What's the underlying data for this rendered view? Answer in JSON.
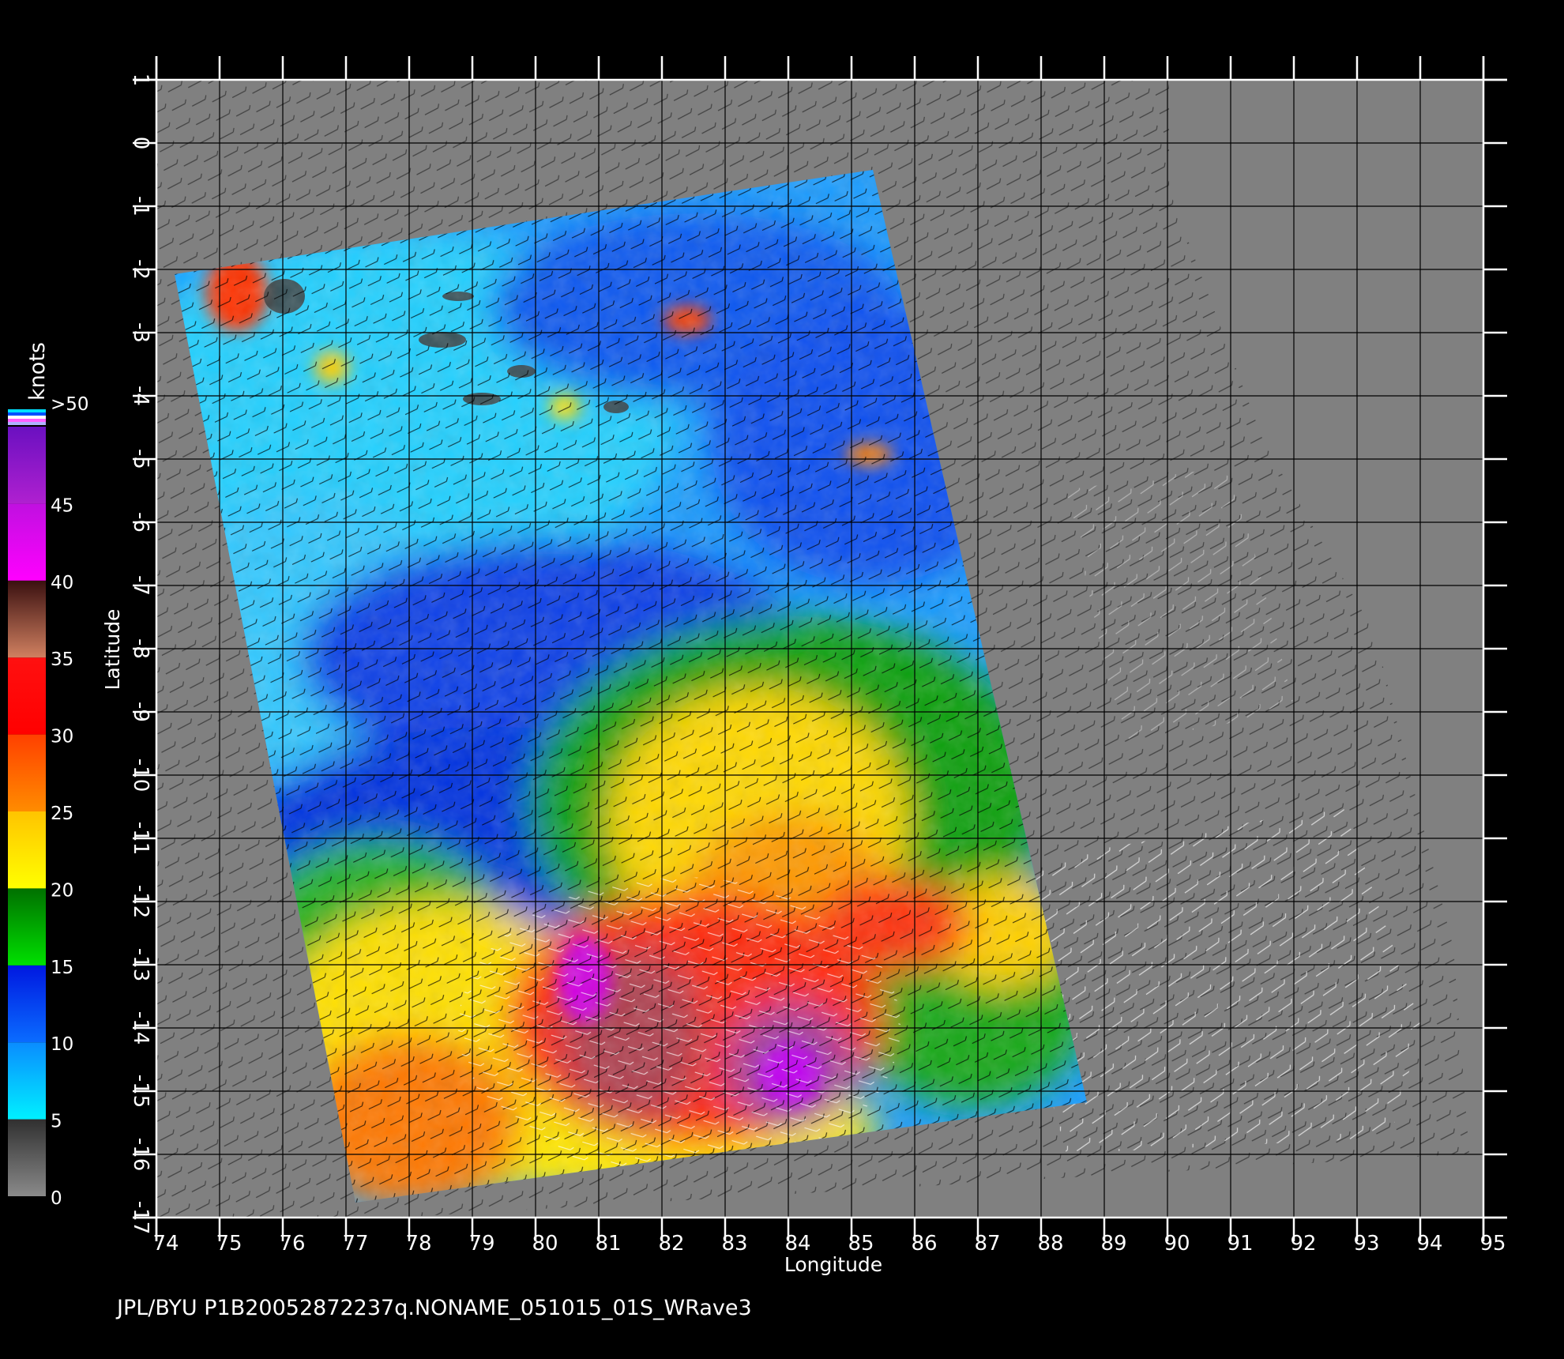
{
  "footer": {
    "caption": "JPL/BYU  P1B20052872237q.NONAME_051015_01S_WRave3"
  },
  "axes": {
    "xlabel": "Longitude",
    "ylabel": "Latitude",
    "x_ticks": [
      "74",
      "75",
      "76",
      "77",
      "78",
      "79",
      "80",
      "81",
      "82",
      "83",
      "84",
      "85",
      "86",
      "87",
      "88",
      "89",
      "90",
      "91",
      "92",
      "93",
      "94",
      "95"
    ],
    "y_ticks": [
      "1",
      "0",
      "-1",
      "-2",
      "-3",
      "-4",
      "-5",
      "-6",
      "-7",
      "-8",
      "-9",
      "-10",
      "-11",
      "-12",
      "-13",
      "-14",
      "-15",
      "-16",
      "-17"
    ],
    "xlim": [
      74,
      95
    ],
    "ylim": [
      -17,
      1
    ]
  },
  "colorbar": {
    "unit": "knots",
    "labels": [
      ">50",
      "45",
      "40",
      "35",
      "30",
      "25",
      "20",
      "15",
      "10",
      "5",
      "0"
    ],
    "segments": [
      {
        "from": 0,
        "to": 5,
        "top": "#303030",
        "bottom": "#8a8a8a"
      },
      {
        "from": 5,
        "to": 10,
        "top": "#0a8cff",
        "bottom": "#00f0ff"
      },
      {
        "from": 10,
        "to": 15,
        "top": "#0018e0",
        "bottom": "#0a6cff"
      },
      {
        "from": 15,
        "to": 20,
        "top": "#007000",
        "bottom": "#00e000"
      },
      {
        "from": 20,
        "to": 25,
        "top": "#ffc400",
        "bottom": "#ffff00"
      },
      {
        "from": 25,
        "to": 30,
        "top": "#ff4000",
        "bottom": "#ff8c00"
      },
      {
        "from": 30,
        "to": 35,
        "top": "#ff1010",
        "bottom": "#ff0000"
      },
      {
        "from": 35,
        "to": 40,
        "top": "#3a1010",
        "bottom": "#d08060"
      },
      {
        "from": 40,
        "to": 45,
        "top": "#c010e0",
        "bottom": "#ff00ff"
      },
      {
        "from": 45,
        "to": 50,
        "top": "#6a10c0",
        "bottom": "#b020d0"
      }
    ]
  },
  "colors": {
    "background": "#000000",
    "plot_background": "#808080",
    "grid": "#000000",
    "text": "#ffffff"
  }
}
